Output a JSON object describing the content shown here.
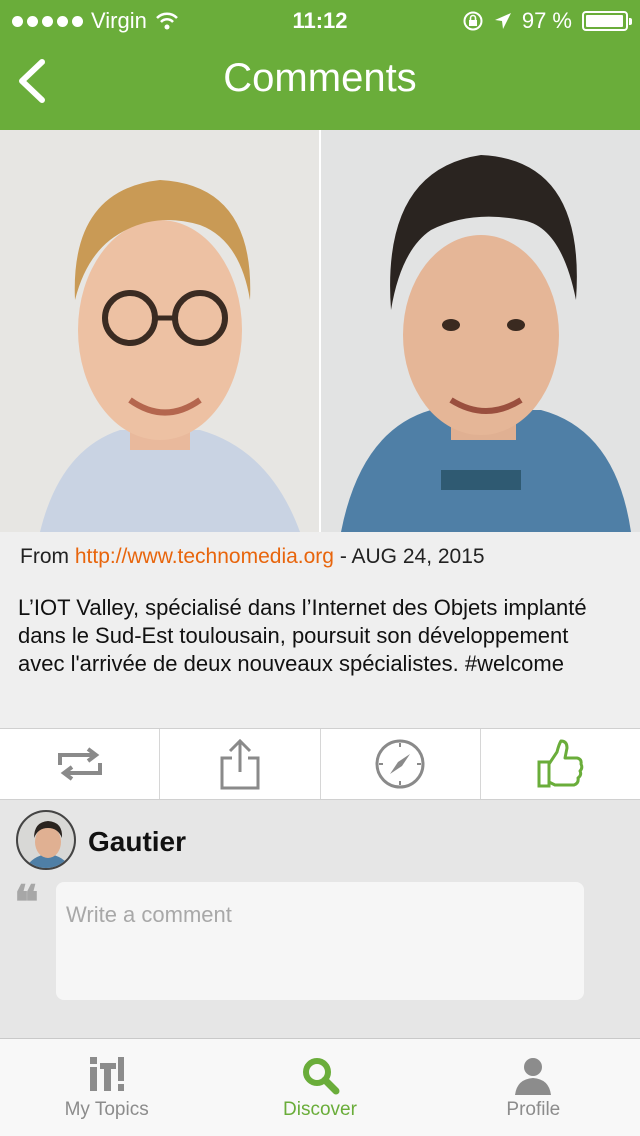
{
  "status_bar": {
    "carrier": "Virgin",
    "time": "11:12",
    "battery": "97 %",
    "battery_level": 0.97
  },
  "nav": {
    "title": "Comments",
    "back_icon": "chevron-left-icon"
  },
  "post": {
    "from_label": "From",
    "source_url": "http://www.technomedia.org",
    "date": "- AUG 24, 2015",
    "text": "L’IOT Valley, spécialisé dans l’Internet des Objets implanté dans le Sud-Est toulousain, poursuit son développement avec l'arrivée de deux nouveaux spécialistes. #welcome"
  },
  "actions": [
    {
      "name": "repost-icon"
    },
    {
      "name": "share-icon"
    },
    {
      "name": "compass-icon"
    },
    {
      "name": "thumbs-up-icon"
    }
  ],
  "comment": {
    "username": "Gautier",
    "placeholder": "Write a comment",
    "quote_glyph": "❝"
  },
  "tabs": [
    {
      "label": "My Topics",
      "icon": "it-logo-icon",
      "active": false
    },
    {
      "label": "Discover",
      "icon": "search-icon",
      "active": true
    },
    {
      "label": "Profile",
      "icon": "person-icon",
      "active": false
    }
  ],
  "colors": {
    "accent": "#6aad3a",
    "link": "#e8650c"
  }
}
